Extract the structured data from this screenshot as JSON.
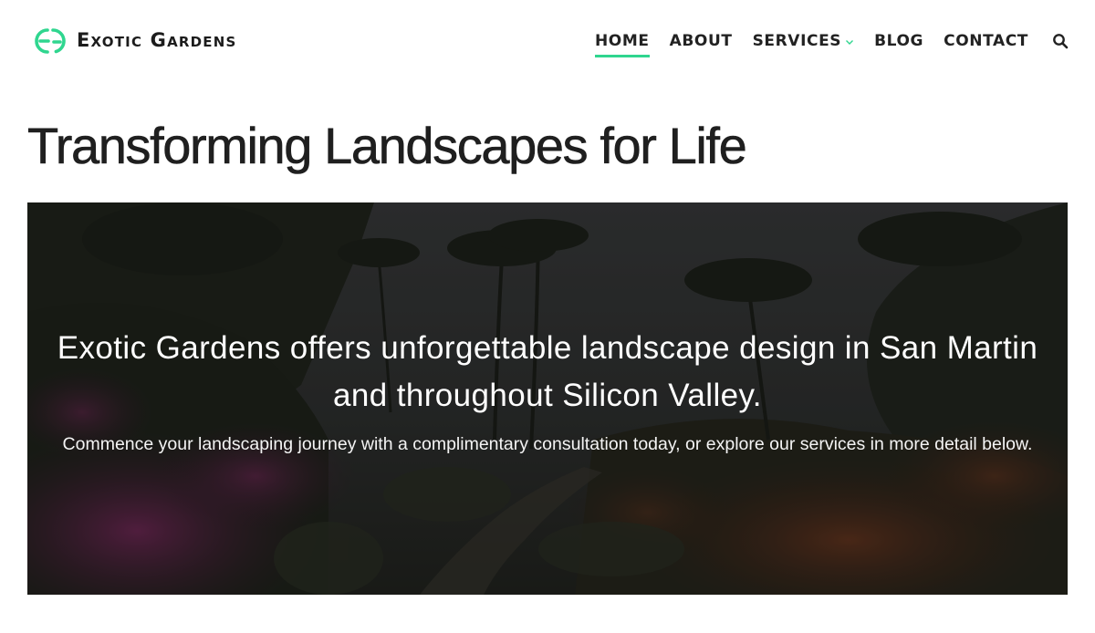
{
  "brand": {
    "name": "Exotic Gardens",
    "accent_color": "#2fd68f",
    "logo_icon": "eg-monogram-icon"
  },
  "nav": {
    "items": [
      {
        "label": "HOME",
        "active": true
      },
      {
        "label": "ABOUT",
        "active": false
      },
      {
        "label": "SERVICES",
        "active": false,
        "has_dropdown": true
      },
      {
        "label": "BLOG",
        "active": false
      },
      {
        "label": "CONTACT",
        "active": false
      }
    ],
    "search_icon": "search-icon",
    "dropdown_icon": "chevron-down-icon"
  },
  "page": {
    "title": "Transforming Landscapes for Life"
  },
  "hero": {
    "heading": "Exotic Gardens offers unforgettable landscape design in San Martin and throughout Silicon Valley.",
    "subtext": "Commence your landscaping journey with a complimentary consultation today, or explore our services in more detail below."
  }
}
